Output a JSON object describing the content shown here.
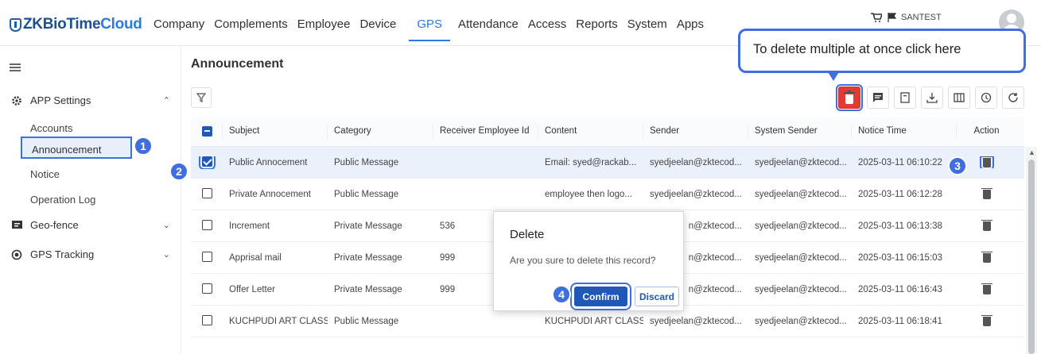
{
  "app": {
    "brand_zk": "ZKBio",
    "brand_time": "Time",
    "brand_cloud": "Cloud"
  },
  "nav": [
    "Company",
    "Complements",
    "Employee",
    "Device",
    "GPS",
    "Attendance",
    "Access",
    "Reports",
    "System",
    "Apps"
  ],
  "nav_active": "GPS",
  "user": {
    "name": "SANTEST"
  },
  "sidebar": {
    "groups": [
      {
        "label": "APP Settings",
        "expanded": true
      },
      {
        "label": "Geo-fence",
        "expanded": false
      },
      {
        "label": "GPS Tracking",
        "expanded": false
      }
    ],
    "items": [
      "Accounts",
      "Announcement",
      "Notice",
      "Operation Log"
    ],
    "active_item": "Announcement"
  },
  "page": {
    "title": "Announcement"
  },
  "table": {
    "headers": [
      "Subject",
      "Category",
      "Receiver Employee Id",
      "Content",
      "Sender",
      "System Sender",
      "Notice Time",
      "Action"
    ],
    "rows": [
      {
        "subject": "Public Annocement",
        "category": "Public Message",
        "receiver": "",
        "content": "Email: syed@rackab...",
        "sender": "syedjeelan@zktecod...",
        "system_sender": "syedjeelan@zktecod...",
        "time": "2025-03-11 06:10:22",
        "checked": true
      },
      {
        "subject": "Private Annocement",
        "category": "Public Message",
        "receiver": "",
        "content": "employee then logo...",
        "sender": "syedjeelan@zktecod...",
        "system_sender": "syedjeelan@zktecod...",
        "time": "2025-03-11 06:12:28",
        "checked": false
      },
      {
        "subject": "Increment",
        "category": "Private Message",
        "receiver": "536",
        "content": "",
        "sender": "n@zktecod...",
        "system_sender": "syedjeelan@zktecod...",
        "time": "2025-03-11 06:13:38",
        "checked": false
      },
      {
        "subject": "Apprisal mail",
        "category": "Private Message",
        "receiver": "999",
        "content": "",
        "sender": "n@zktecod...",
        "system_sender": "syedjeelan@zktecod...",
        "time": "2025-03-11 06:15:03",
        "checked": false
      },
      {
        "subject": "Offer Letter",
        "category": "Private Message",
        "receiver": "999",
        "content": "",
        "sender": "n@zktecod...",
        "system_sender": "syedjeelan@zktecod...",
        "time": "2025-03-11 06:16:43",
        "checked": false
      },
      {
        "subject": "KUCHPUDI ART CLASS...",
        "category": "Public Message",
        "receiver": "",
        "content": "KUCHPUDI ART CLASS...",
        "sender": "syedjeelan@zktecod...",
        "system_sender": "syedjeelan@zktecod...",
        "time": "2025-03-11 06:18:41",
        "checked": false
      }
    ]
  },
  "callout": {
    "text": "To delete multiple at once click here"
  },
  "dialog": {
    "title": "Delete",
    "message": "Are you sure to delete this record?",
    "confirm": "Confirm",
    "discard": "Discard"
  },
  "badges": [
    "1",
    "2",
    "3",
    "4"
  ],
  "colors": {
    "primary": "#1f58b8",
    "accent": "#2a7ae2",
    "danger": "#e53935",
    "highlight": "#3f6ee0"
  },
  "icons": [
    "collapse-icon",
    "gear-icon",
    "chat-icon",
    "gps-target-icon",
    "filter-icon",
    "trash-icon",
    "message-icon",
    "document-icon",
    "download-icon",
    "columns-icon",
    "history-icon",
    "refresh-icon",
    "cart-icon",
    "flag-icon"
  ]
}
